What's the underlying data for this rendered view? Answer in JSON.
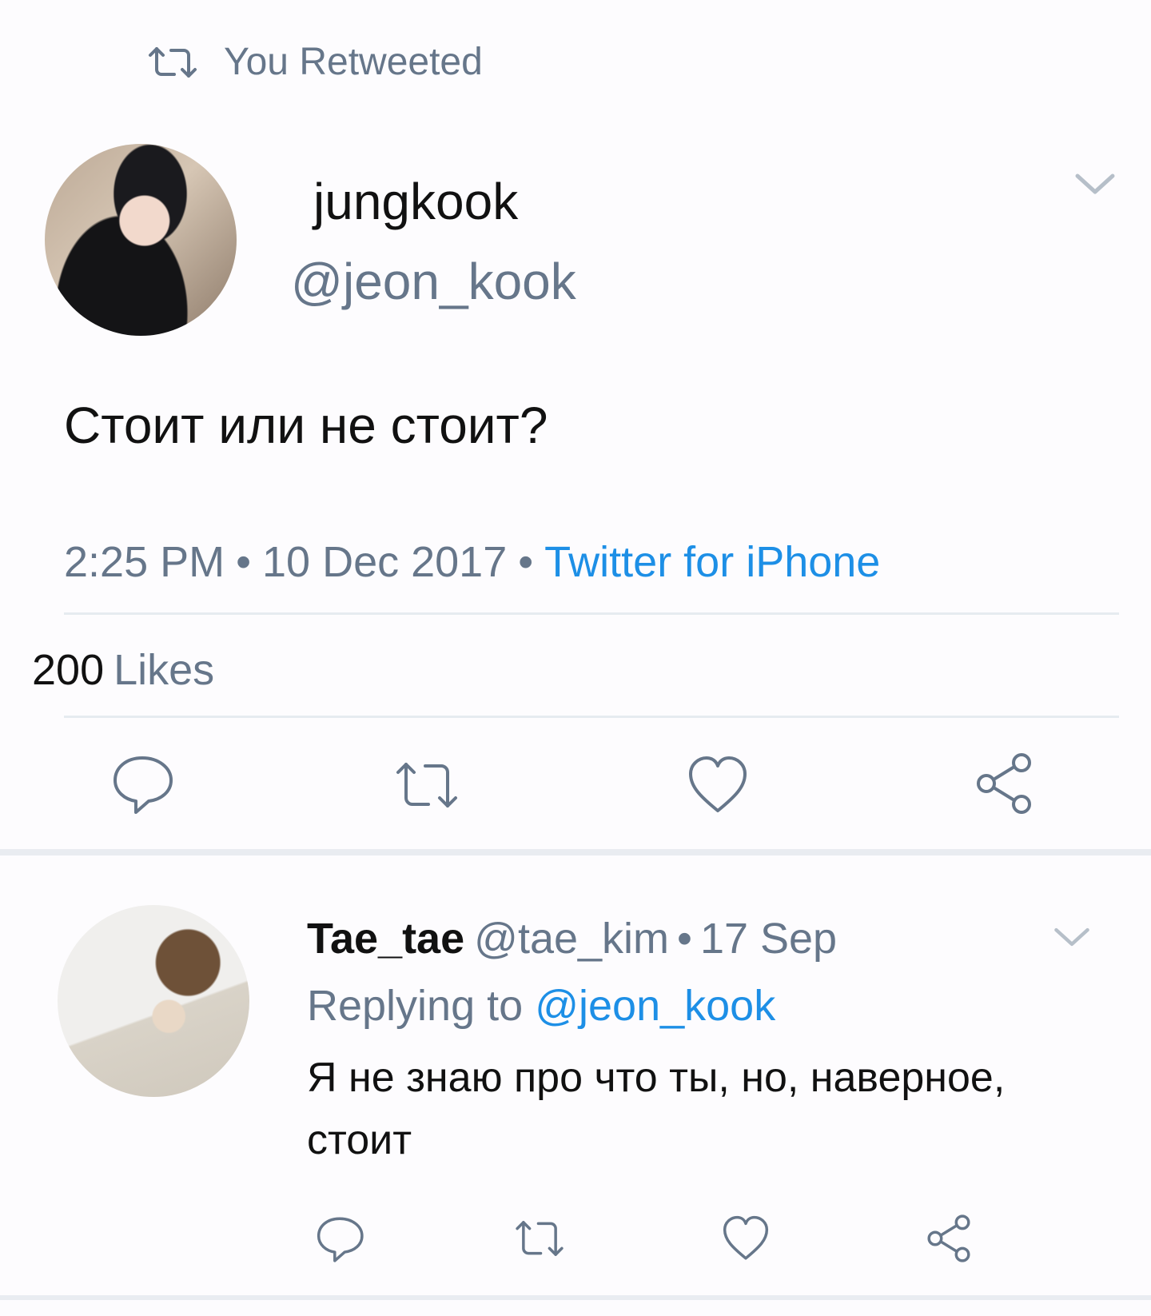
{
  "retweet_banner": {
    "icon": "retweet-icon",
    "text": "You Retweeted"
  },
  "main_tweet": {
    "author": {
      "display_name": "jungkook",
      "handle": "@jeon_kook"
    },
    "text": "Стоит или не стоит?",
    "time": "2:25 PM",
    "separator": "•",
    "date": "10 Dec 2017",
    "client": "Twitter for iPhone",
    "likes": {
      "count": "200",
      "label": "Likes"
    },
    "actions": [
      "reply-icon",
      "retweet-icon",
      "like-icon",
      "share-icon"
    ]
  },
  "reply_tweet": {
    "author": {
      "display_name": "Tae_tae",
      "handle": "@tae_kim"
    },
    "separator": "•",
    "date": "17 Sep",
    "replying_prefix": "Replying to",
    "replying_to": "@jeon_kook",
    "text": "Я не знаю про что ты, но, наверное, стоит",
    "actions": [
      "reply-icon",
      "retweet-icon",
      "like-icon",
      "share-icon"
    ]
  },
  "colors": {
    "muted": "#66768a",
    "link": "#1d8fe6",
    "divider": "#e6ebf0",
    "background": "#fdfcfe"
  }
}
